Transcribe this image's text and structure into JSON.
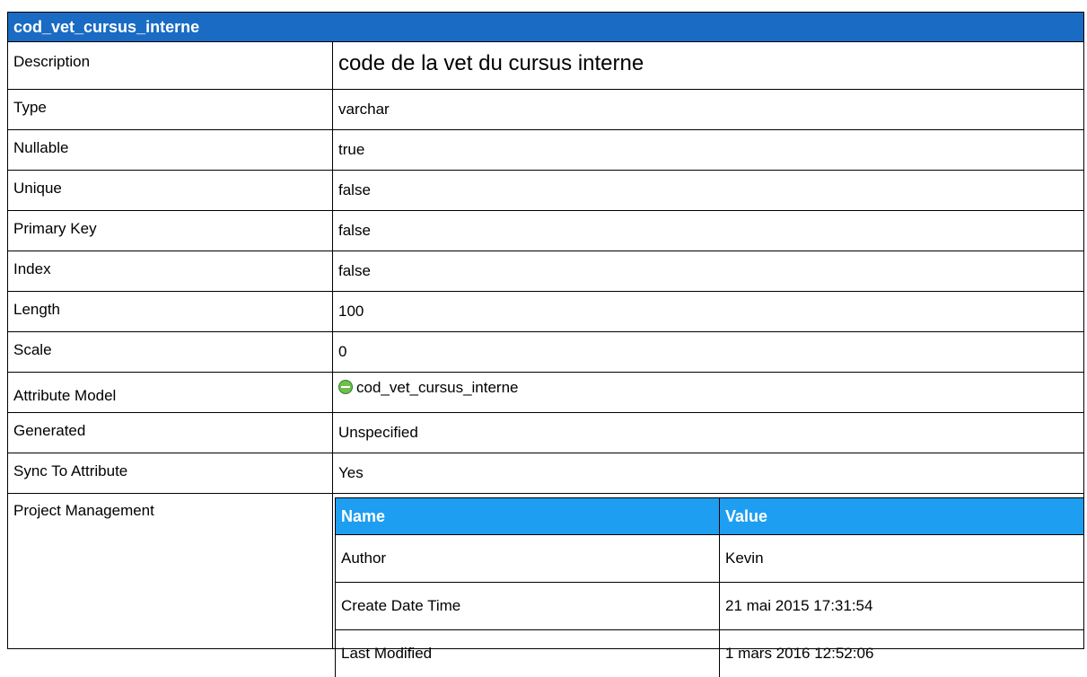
{
  "title": "cod_vet_cursus_interne",
  "rows": [
    {
      "label": "Description",
      "value": "code de la vet du cursus interne"
    },
    {
      "label": "Type",
      "value": "varchar"
    },
    {
      "label": "Nullable",
      "value": "true"
    },
    {
      "label": "Unique",
      "value": "false"
    },
    {
      "label": "Primary Key",
      "value": "false"
    },
    {
      "label": "Index",
      "value": "false"
    },
    {
      "label": "Length",
      "value": "100"
    },
    {
      "label": "Scale",
      "value": "0"
    },
    {
      "label": "Attribute Model",
      "value": "cod_vet_cursus_interne",
      "icon": "attribute-model-icon"
    },
    {
      "label": "Generated",
      "value": "Unspecified"
    },
    {
      "label": "Sync To Attribute",
      "value": "Yes"
    }
  ],
  "project_management": {
    "label": "Project Management",
    "headers": {
      "name": "Name",
      "value": "Value"
    },
    "rows": [
      {
        "name": "Author",
        "value": "Kevin"
      },
      {
        "name": "Create Date Time",
        "value": "21 mai 2015 17:31:54"
      },
      {
        "name": "Last Modified",
        "value": "1 mars 2016 12:52:06"
      }
    ]
  },
  "colors": {
    "title_bar": "#1a6bc4",
    "table_header": "#1e9ef0",
    "icon_green": "#6fbf4a"
  }
}
